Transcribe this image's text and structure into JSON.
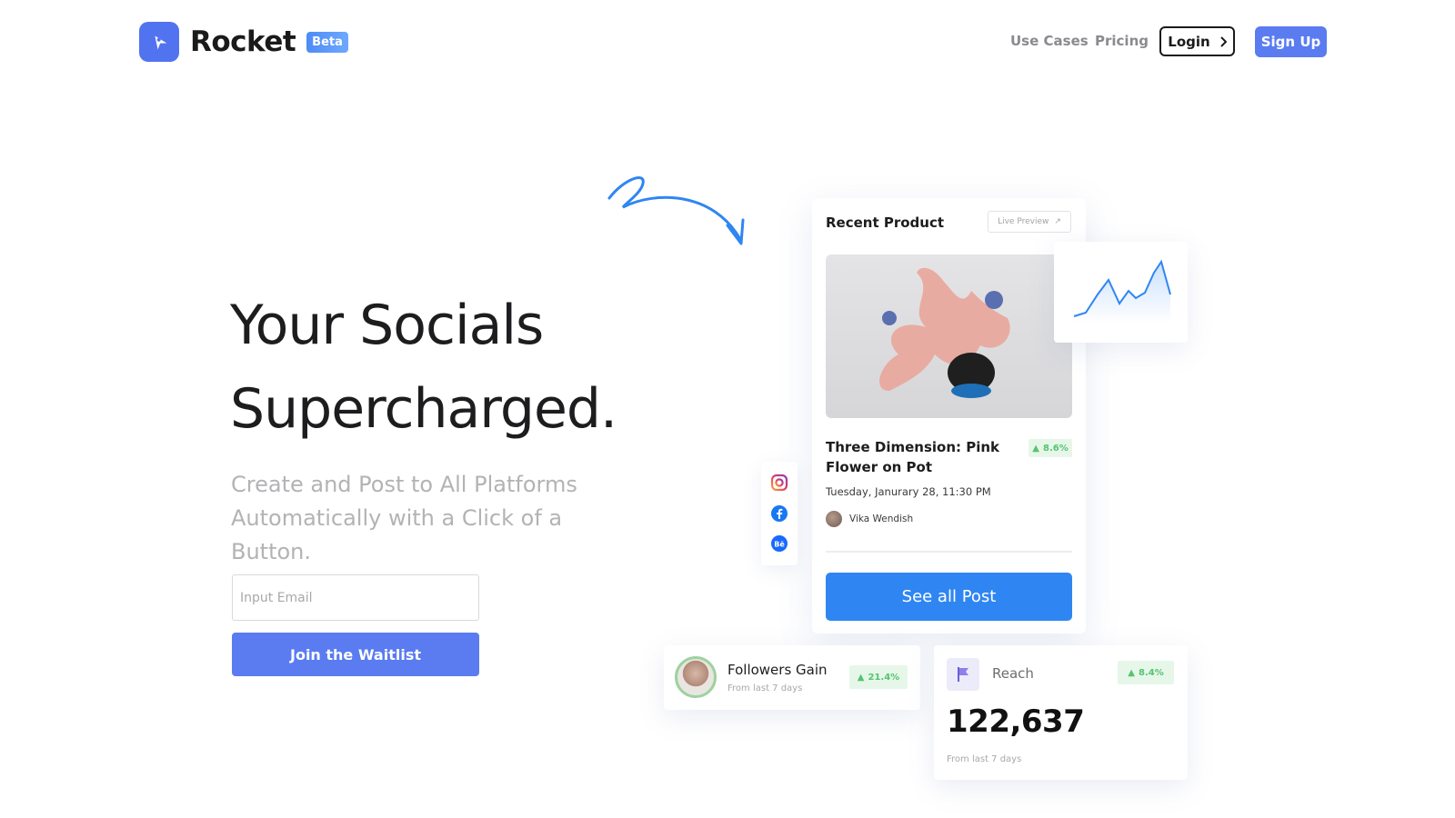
{
  "brand": {
    "name": "Rocket",
    "badge": "Beta",
    "accent": "#5a7cf0"
  },
  "nav": {
    "use_cases": "Use Cases",
    "pricing": "Pricing",
    "login": "Login",
    "signup": "Sign Up"
  },
  "hero": {
    "title_line1": "Your Socials",
    "title_line2": "Supercharged.",
    "subtitle_line1": "Create and Post to All Platforms",
    "subtitle_line2": "Automatically with a Click of a Button.",
    "email_placeholder": "Input Email",
    "cta": "Join the Waitlist"
  },
  "product_card": {
    "title": "Recent Product",
    "live_preview": "Live Preview",
    "product_name": "Three Dimension: Pink Flower on Pot",
    "change": "8.6%",
    "date": "Tuesday, Janurary 28, 11:30 PM",
    "author": "Vika Wendish",
    "button": "See all Post"
  },
  "social_icons": [
    "instagram-icon",
    "facebook-icon",
    "behance-icon"
  ],
  "followers_card": {
    "title": "Followers Gain",
    "subtitle": "From last 7 days",
    "change": "21.4%"
  },
  "reach_card": {
    "label": "Reach",
    "value": "122,637",
    "subtitle": "From last 7 days",
    "change": "8.4%"
  },
  "colors": {
    "primary_button": "#5a7cf0",
    "see_all_button": "#2f86f2",
    "positive": "#55c36f"
  }
}
